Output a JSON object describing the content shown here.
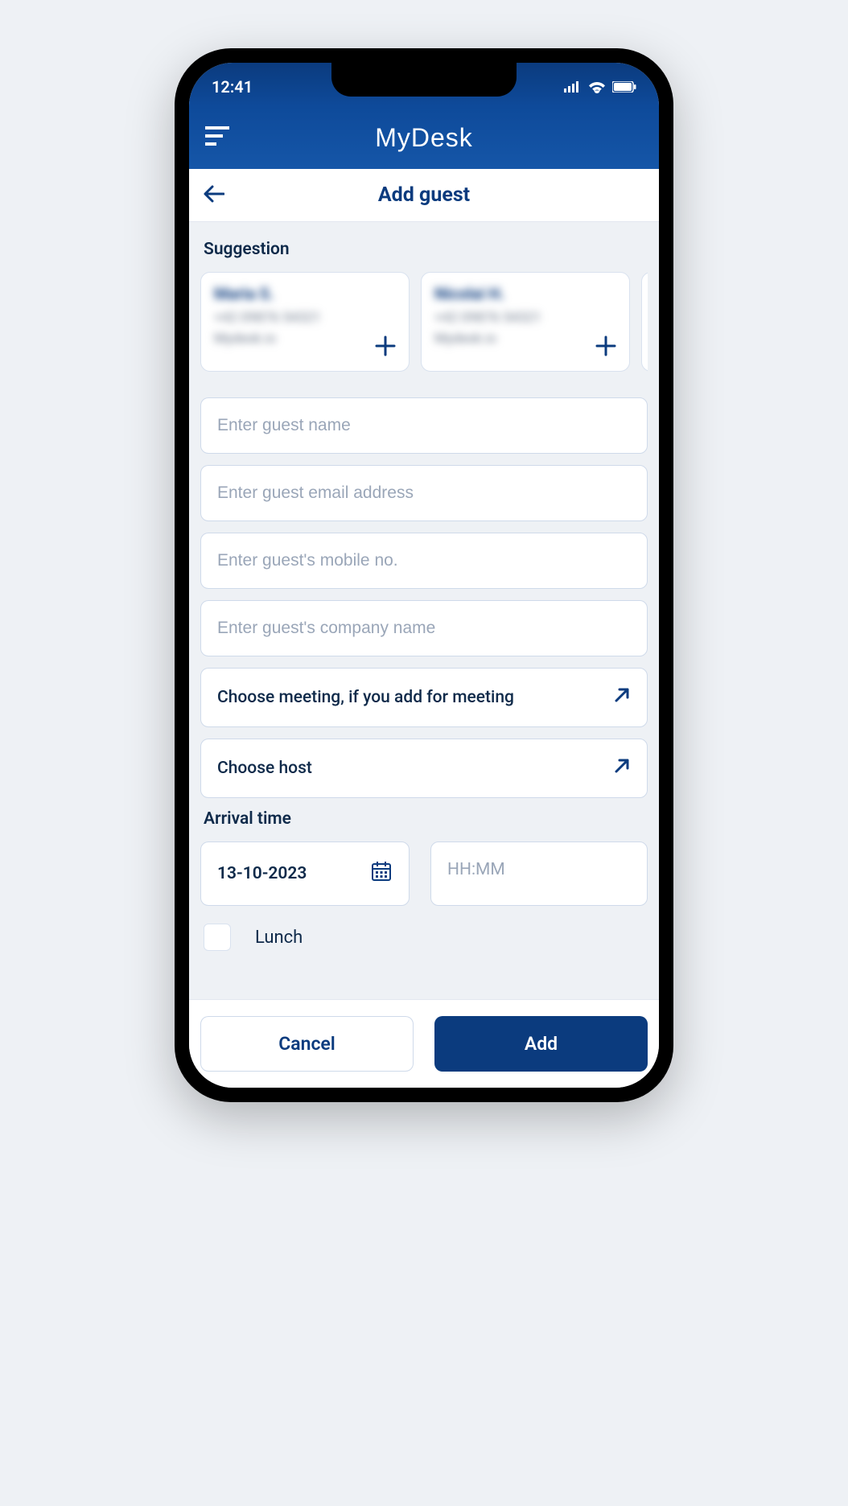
{
  "status": {
    "time": "12:41"
  },
  "app": {
    "title": "MyDesk"
  },
  "page": {
    "title": "Add guest"
  },
  "suggestion": {
    "label": "Suggestion",
    "cards": [
      {
        "name": "Maria S.",
        "phone": "+42 09876 54321",
        "domain": "Mydesk.io"
      },
      {
        "name": "Nicolai H.",
        "phone": "+42 09876 54321",
        "domain": "Mydesk.io"
      }
    ]
  },
  "form": {
    "name_placeholder": "Enter guest name",
    "email_placeholder": "Enter guest email address",
    "mobile_placeholder": "Enter guest's mobile no.",
    "company_placeholder": "Enter guest's company name",
    "meeting_label": "Choose meeting, if you add for meeting",
    "host_label": "Choose host"
  },
  "arrival": {
    "label": "Arrival time",
    "date": "13-10-2023",
    "time_placeholder": "HH:MM"
  },
  "lunch": {
    "label": "Lunch"
  },
  "actions": {
    "cancel": "Cancel",
    "add": "Add"
  }
}
